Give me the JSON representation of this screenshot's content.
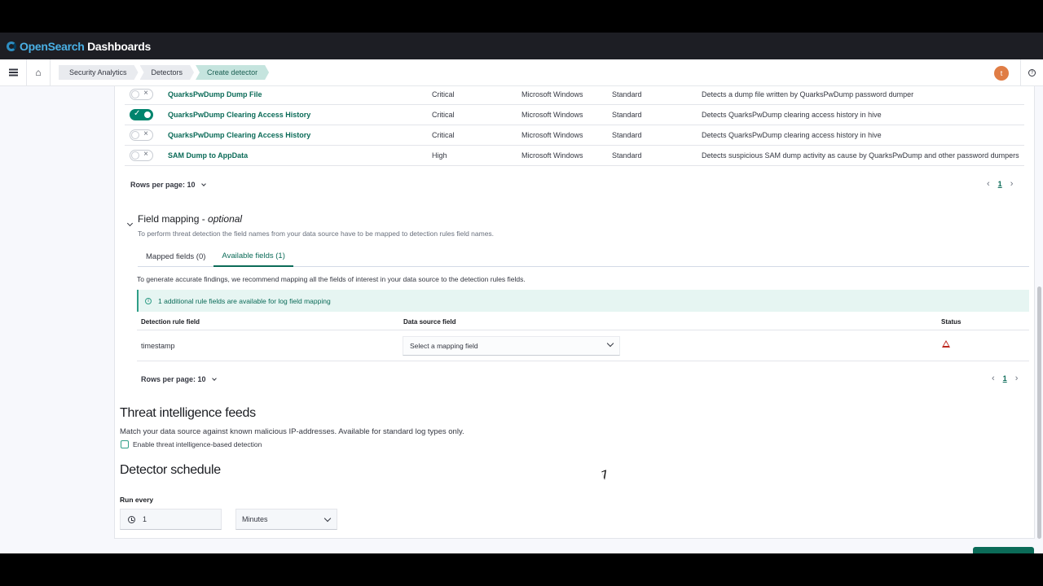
{
  "app": {
    "brand_prefix": "OpenSearch",
    "brand_suffix": " Dashboards"
  },
  "breadcrumbs": [
    "Security Analytics",
    "Detectors",
    "Create detector"
  ],
  "user": {
    "avatar_initial": "t"
  },
  "rules": [
    {
      "name": "QuarksPwDump Dump File",
      "severity": "Critical",
      "log_source": "Microsoft Windows",
      "type": "Standard",
      "description": "Detects a dump file written by QuarksPwDump password dumper",
      "enabled": false
    },
    {
      "name": "QuarksPwDump Clearing Access History",
      "severity": "Critical",
      "log_source": "Microsoft Windows",
      "type": "Standard",
      "description": "Detects QuarksPwDump clearing access history in hive",
      "enabled": true
    },
    {
      "name": "QuarksPwDump Clearing Access History",
      "severity": "Critical",
      "log_source": "Microsoft Windows",
      "type": "Standard",
      "description": "Detects QuarksPwDump clearing access history in hive",
      "enabled": false
    },
    {
      "name": "SAM Dump to AppData",
      "severity": "High",
      "log_source": "Microsoft Windows",
      "type": "Standard",
      "description": "Detects suspicious SAM dump activity as cause by QuarksPwDump and other password dumpers",
      "enabled": false
    }
  ],
  "rules_pagination": {
    "rows_per_page": "Rows per page: 10",
    "current_page": "1"
  },
  "field_mapping": {
    "title": "Field mapping - ",
    "title_optional": "optional",
    "description": "To perform threat detection the field names from your data source have to be mapped to detection rules field names.",
    "tabs": [
      "Mapped fields (0)",
      "Available fields (1)"
    ],
    "recommendation": "To generate accurate findings, we recommend mapping all the fields of interest in your data source to the detection rules fields.",
    "callout": "1 additional rule fields are available for log field mapping",
    "columns": {
      "rule_field": "Detection rule field",
      "source_field": "Data source field",
      "status": "Status"
    },
    "rows": [
      {
        "rule_field": "timestamp",
        "placeholder": "Select a mapping field"
      }
    ],
    "rows_per_page": "Rows per page: 10",
    "current_page": "1"
  },
  "threat_intel": {
    "title": "Threat intelligence feeds",
    "description": "Match your data source against known malicious IP-addresses. Available for standard log types only.",
    "checkbox_label": "Enable threat intelligence-based detection",
    "checked": false
  },
  "schedule": {
    "title": "Detector schedule",
    "run_every_label": "Run every",
    "interval_value": "1",
    "unit": "Minutes"
  },
  "colors": {
    "accent": "#0b6b58",
    "appbar": "#1d1e24",
    "warning": "#bd271e"
  }
}
